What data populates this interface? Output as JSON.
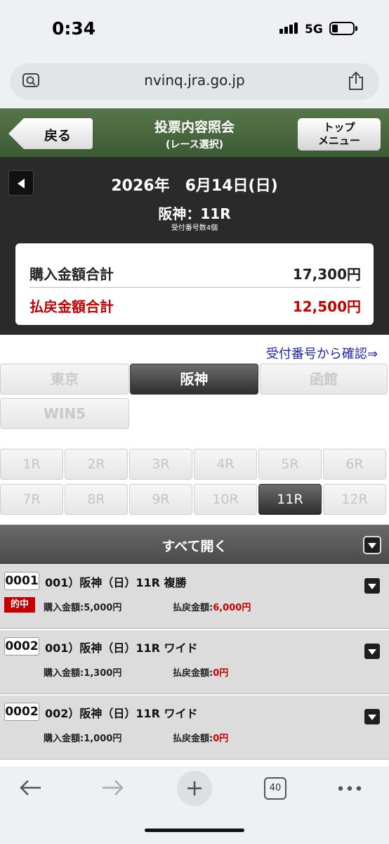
{
  "status_bar": {
    "time": "0:34",
    "network": "5G",
    "battery_level": 0.3
  },
  "browser": {
    "url": "nvinq.jra.go.jp",
    "tab_count": "40"
  },
  "header": {
    "back_label": "戻る",
    "title": "投票内容照会",
    "subtitle": "(レース選択)",
    "top_menu_line1": "トップ",
    "top_menu_line2": "メニュー",
    "accent_color": "#4a6a3f"
  },
  "date_bar": {
    "date": "2026年　6月14日(日)",
    "race": "阪神：11R",
    "receipt_count": "受付番号数4個"
  },
  "totals": {
    "purchase_label": "購入金額合計",
    "purchase_value": "17,300円",
    "refund_label": "払戻金額合計",
    "refund_value": "12,500円"
  },
  "confirm_link": "受付番号から確認⇒",
  "venues": [
    "東京",
    "阪神",
    "函館",
    "WIN5"
  ],
  "venue_selected": "阪神",
  "races": [
    "1R",
    "2R",
    "3R",
    "4R",
    "5R",
    "6R",
    "7R",
    "8R",
    "9R",
    "10R",
    "11R",
    "12R"
  ],
  "race_selected": "11R",
  "open_all_label": "すべて開く",
  "records": [
    {
      "receipt": "0001",
      "title": "001）阪神（日）11R 複勝",
      "hit_label": "的中",
      "buy_label": "購入金額:",
      "buy": "5,000円",
      "pay_label": "払戻金額:",
      "pay": "6,000円"
    },
    {
      "receipt": "0002",
      "title": "001）阪神（日）11R ワイド",
      "hit_label": "",
      "buy_label": "購入金額:",
      "buy": "1,300円",
      "pay_label": "払戻金額:",
      "pay": "0円"
    },
    {
      "receipt": "0002",
      "title": "002）阪神（日）11R ワイド",
      "hit_label": "",
      "buy_label": "購入金額:",
      "buy": "1,000円",
      "pay_label": "払戻金額:",
      "pay": "0円"
    }
  ]
}
